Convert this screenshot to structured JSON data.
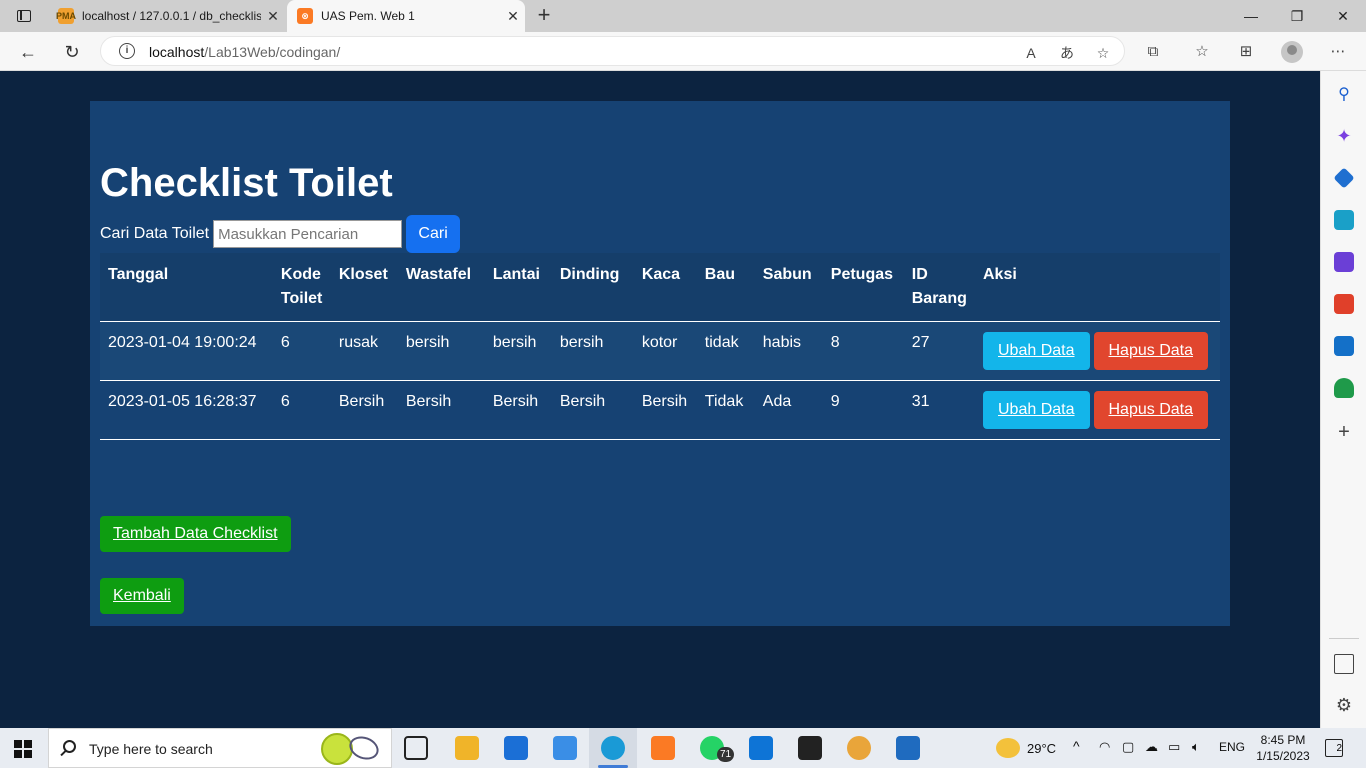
{
  "browser": {
    "tabs": [
      {
        "title": "localhost / 127.0.0.1 / db_checklis",
        "favicon": "phpmyadmin-icon",
        "active": false
      },
      {
        "title": "UAS Pem. Web 1",
        "favicon": "xampp-icon",
        "active": true
      }
    ],
    "url_host": "localhost",
    "url_path": "/Lab13Web/codingan/"
  },
  "page": {
    "title": "Checklist Toilet",
    "search_label": "Cari Data Toilet",
    "search_placeholder": "Masukkan Pencarian",
    "search_button": "Cari",
    "table": {
      "headers": [
        "Tanggal",
        "Kode Toilet",
        "Kloset",
        "Wastafel",
        "Lantai",
        "Dinding",
        "Kaca",
        "Bau",
        "Sabun",
        "Petugas",
        "ID Barang",
        "Aksi"
      ],
      "rows": [
        {
          "tanggal": "2023-01-04 19:00:24",
          "kode_toilet": "6",
          "kloset": "rusak",
          "wastafel": "bersih",
          "lantai": "bersih",
          "dinding": "bersih",
          "kaca": "kotor",
          "bau": "tidak",
          "sabun": "habis",
          "petugas": "8",
          "id_barang": "27"
        },
        {
          "tanggal": "2023-01-05 16:28:37",
          "kode_toilet": "6",
          "kloset": "Bersih",
          "wastafel": "Bersih",
          "lantai": "Bersih",
          "dinding": "Bersih",
          "kaca": "Bersih",
          "bau": "Tidak",
          "sabun": "Ada",
          "petugas": "9",
          "id_barang": "31"
        }
      ],
      "edit_label": "Ubah Data",
      "delete_label": "Hapus Data"
    },
    "add_button": "Tambah Data Checklist",
    "back_button": "Kembali",
    "colors": {
      "background": "#0c2340",
      "container": "#164273",
      "primary": "#1570f0",
      "info": "#13b5ea",
      "danger": "#e1462e",
      "success": "#0e9d11"
    }
  },
  "taskbar": {
    "search_placeholder": "Type here to search",
    "whatsapp_badge": "71",
    "weather": "29°C",
    "language": "ENG",
    "time": "8:45 PM",
    "date": "1/15/2023",
    "notifications": "2"
  }
}
